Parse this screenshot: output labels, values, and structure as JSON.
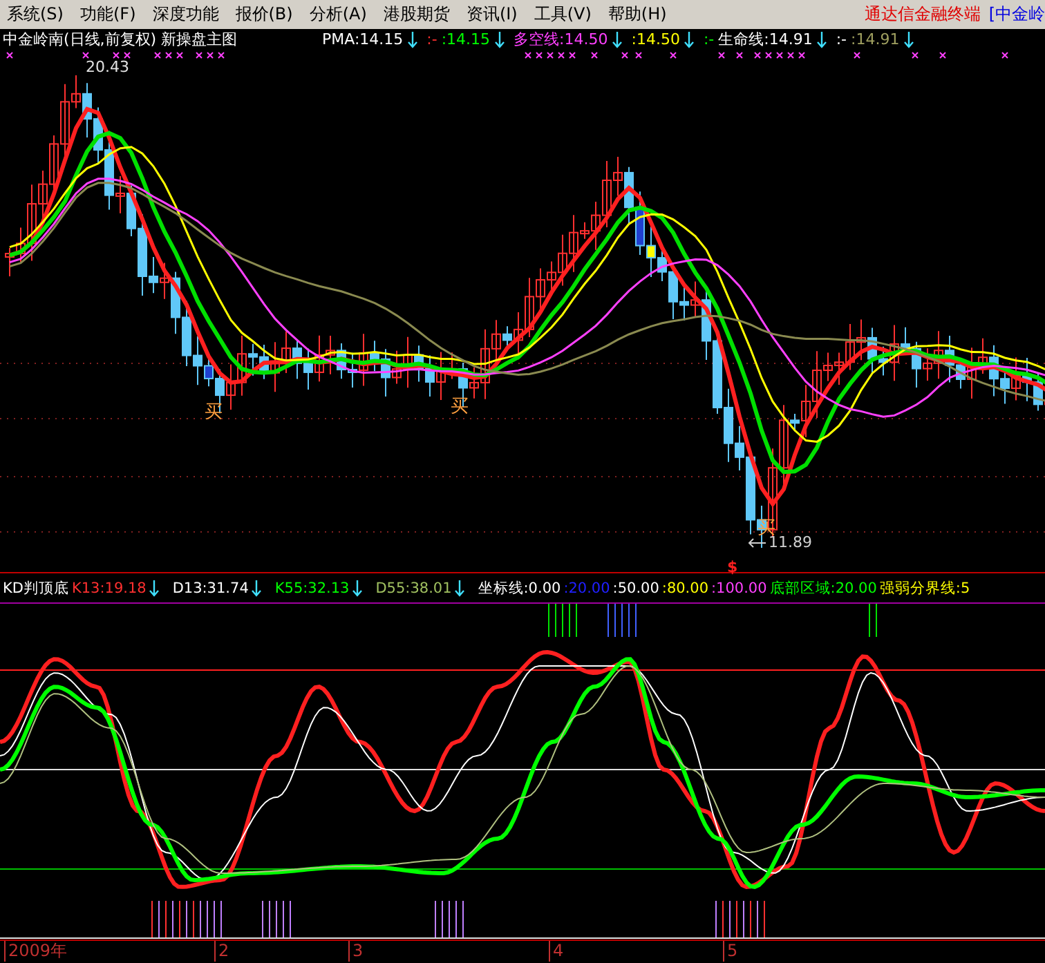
{
  "menu": {
    "items": [
      {
        "label": "系统(S)"
      },
      {
        "label": "功能(F)"
      },
      {
        "label": "深度功能"
      },
      {
        "label": "报价(B)"
      },
      {
        "label": "分析(A)"
      },
      {
        "label": "港股期货"
      },
      {
        "label": "资讯(I)"
      },
      {
        "label": "工具(V)"
      },
      {
        "label": "帮助(H)"
      }
    ],
    "brand": "通达信金融终端",
    "stock_tab": "[中金岭"
  },
  "price_panel": {
    "legend": [
      {
        "text": "中金岭南(日线,前复权) 新操盘主图",
        "color": "#ffffff",
        "arrow": false
      },
      {
        "text": "PMA:14.15",
        "color": "#ffffff",
        "arrow": true
      },
      {
        "text": ":-",
        "color": "#ff3030",
        "arrow": false
      },
      {
        "text": ":14.15",
        "color": "#00ff00",
        "arrow": true
      },
      {
        "text": "多空线:14.50",
        "color": "#ff40ff",
        "arrow": true
      },
      {
        "text": ":14.50",
        "color": "#ffff00",
        "arrow": true
      },
      {
        "text": ":-",
        "color": "#00ff00",
        "arrow": false
      },
      {
        "text": "生命线:14.91",
        "color": "#ffffff",
        "arrow": true
      },
      {
        "text": ":-",
        "color": "#ffffff",
        "arrow": false
      },
      {
        "text": ":14.91",
        "color": "#a0a060",
        "arrow": true
      }
    ],
    "labels": [
      {
        "kind": "high",
        "text": "20.43"
      },
      {
        "kind": "buy",
        "text": "买"
      },
      {
        "kind": "buy",
        "text": "买"
      },
      {
        "kind": "buy",
        "text": "买"
      },
      {
        "kind": "low",
        "text": "11.89"
      },
      {
        "kind": "signal",
        "text": "$"
      }
    ]
  },
  "indicator_panel": {
    "legend": [
      {
        "text": "KD判顶底",
        "color": "#ffffff",
        "arrow": false
      },
      {
        "text": "K13:19.18",
        "color": "#ff3030",
        "arrow": true
      },
      {
        "text": "D13:31.74",
        "color": "#ffffff",
        "arrow": true
      },
      {
        "text": "K55:32.13",
        "color": "#00ff00",
        "arrow": true
      },
      {
        "text": "D55:38.01",
        "color": "#a0c060",
        "arrow": true
      },
      {
        "text": "坐标线:0.00",
        "color": "#ffffff",
        "arrow": false
      },
      {
        "text": ":20.00",
        "color": "#2020ff",
        "arrow": false
      },
      {
        "text": ":50.00",
        "color": "#ffffff",
        "arrow": false
      },
      {
        "text": ":80.00",
        "color": "#ffff00",
        "arrow": false
      },
      {
        "text": ":100.00",
        "color": "#ff40ff",
        "arrow": false
      },
      {
        "text": "底部区域:20.00",
        "color": "#00ff00",
        "arrow": false
      },
      {
        "text": "强弱分界线:5",
        "color": "#ffff00",
        "arrow": false
      }
    ]
  },
  "time_axis": {
    "labels": [
      "2009年",
      "2",
      "3",
      "4",
      "5"
    ]
  }
}
